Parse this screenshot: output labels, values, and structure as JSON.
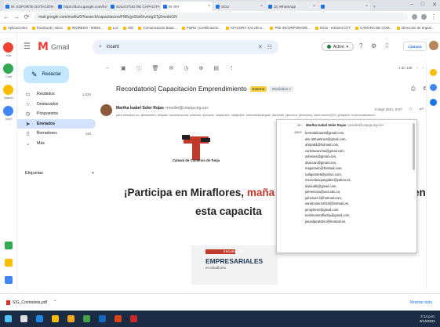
{
  "browser": {
    "tabs": [
      {
        "label": "M: SOPORTE DOTACIÓN - Chat",
        "active": false
      },
      {
        "label": "https://docs.google.com/for",
        "active": false
      },
      {
        "label": "SOLICITUD DE CAPACITACIÓ",
        "active": false
      },
      {
        "label": "M: RH",
        "active": true
      },
      {
        "label": "SOLI",
        "active": false
      },
      {
        "label": "(2) WhatsApp",
        "active": false
      },
      {
        "label": "",
        "active": false
      }
    ],
    "window_controls": [
      "–",
      "□",
      "✕"
    ],
    "url": "mail.google.com/mail/u/0/#search/capacitacion/FMfcgzGtxKhvmrgSTjZmxdnGN",
    "bookmarks": [
      "Aplicaciones",
      "Facebook | Inicio",
      "INGRESO - MINIS...",
      "Loc",
      "SIG",
      "Comunicación Basic...",
      "PQRS | Certificación...",
      "ATACORA SALUD IL...",
      "PMI INCORPORADE...",
      "Inicio - Intranet CCT",
      "CÁMARA DE COM...",
      "Dirección de Impue..."
    ]
  },
  "rail": [
    {
      "label": "Mail",
      "color": "#ea4335"
    },
    {
      "label": "Chat",
      "color": "#34a853"
    },
    {
      "label": "Spaces",
      "color": "#fbbc04"
    },
    {
      "label": "Meet",
      "color": "#4285f4"
    }
  ],
  "header": {
    "app_name": "Gmail",
    "search_value": "incent",
    "status_label": "Activo",
    "account_badge": "CÁMARA"
  },
  "nav": {
    "compose_label": "Redactar",
    "items": [
      {
        "label": "Recibidos",
        "count": "1.025",
        "icon": "inbox-icon",
        "active": false
      },
      {
        "label": "Destacados",
        "count": "",
        "icon": "star-icon",
        "active": false
      },
      {
        "label": "Pospuestos",
        "count": "",
        "icon": "clock-icon",
        "active": false
      },
      {
        "label": "Enviados",
        "count": "",
        "icon": "send-icon",
        "active": true
      },
      {
        "label": "Borradores",
        "count": "115",
        "icon": "draft-icon",
        "active": false
      },
      {
        "label": "Más",
        "count": "",
        "icon": "chevron-down-icon",
        "active": false
      }
    ],
    "labels_title": "Etiquetas",
    "labels_add": "+"
  },
  "toolbar": {
    "icons": [
      "back-arrow-icon",
      "archive-icon",
      "report-spam-icon",
      "delete-icon",
      "mark-unread-icon",
      "snooze-icon",
      "add-task-icon",
      "move-to-icon",
      "more-icon"
    ],
    "pager": "1 de 135"
  },
  "message": {
    "subject": "Recordatorio] Capacitación Emprendimiento",
    "badge_external": "Externo",
    "badge_inbox": "Recibidos ×",
    "sender_name": "Martha Isabel Soler Rojas",
    "sender_email": "<msoler@ccturja.org.co>",
    "to_line": "para bernala.k.ko, alcidesmtm, ahepa6, cartonarancha, avfenias, duecane, mapamelo, nafaponte, mercedesquingale, daroulsie, jainmora, jalnesurey, santromeno2019, jenaylere, turismonatmatevo",
    "time": "9 sept 2021, 9:07",
    "meta_icons": [
      "star-icon",
      "reply-icon",
      "more-icon"
    ]
  },
  "body": {
    "org_name": "Cámara de Comercio de Tunja",
    "headline_part1": "¡Participa en Miraflores, ",
    "headline_red": "maña",
    "headline_tail": "en",
    "headline_line2": "esta capacita",
    "banner_top": "ESCUELA DE",
    "banner_title": "EMPRESARIALES",
    "banner_sub": "en Miraflores"
  },
  "popup": {
    "from_label": "de:",
    "from_name": "Martha Isabel Soler Rojas",
    "from_email": "<msoler@ccturja.org.co>",
    "to_label": "para:",
    "recipients": [
      "bernalalicia33@gmail.com,",
      "alci.40martinez@gmail.com,",
      "ahrpa83@hotmail.com,",
      "carlosarancha@gmail.com,",
      "avfenias@gmail.com,",
      "dsaccan@gmail.com,",
      "mapamelo@hotmail.com,",
      "nafaponte9@yahoo.com,",
      "mercedesquingalez@yahoo.es,",
      "daroulds@gmail.com,",
      "jaimemora@ucs.edu.co,",
      "jainesure.l@hotmail.com,",
      "santiromero2019@hotmail.es,",
      "jenaylerez@gmail.com,",
      "turismomiraflodoy@gmail.com,",
      "jsesalpicaldero@hotmail.es,"
    ]
  },
  "downloads": {
    "file_name": "SIG_Contratista.pdf",
    "show_all": "Mostrar todo"
  },
  "taskbar": {
    "apps": [
      {
        "name": "start-icon",
        "color": "#4fc3f7"
      },
      {
        "name": "search-icon",
        "color": "#e0e0e0"
      },
      {
        "name": "edge-icon",
        "color": "#1e88e5"
      },
      {
        "name": "chrome-icon",
        "color": "#fbbc04"
      },
      {
        "name": "files-icon",
        "color": "#f9a825"
      },
      {
        "name": "photos-icon",
        "color": "#43a047"
      },
      {
        "name": "word-icon",
        "color": "#1565c0"
      },
      {
        "name": "powerpoint-icon",
        "color": "#d84315"
      },
      {
        "name": "app-icon",
        "color": "#c62828"
      }
    ],
    "time": "2:14 p.m.",
    "date": "9/14/2021"
  },
  "colors": {
    "gmail_red": "#ea4335",
    "accent_blue": "#1a73e8",
    "active_nav": "#d3e3fd",
    "compose": "#c2e7ff"
  }
}
